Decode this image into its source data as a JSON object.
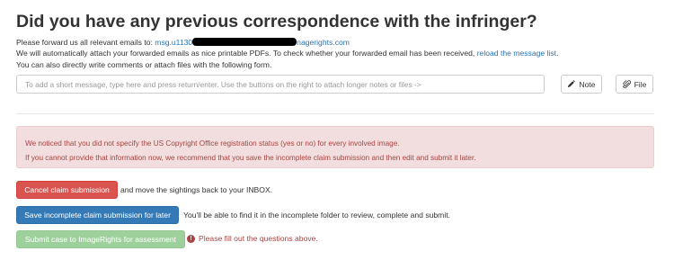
{
  "heading": "Did you have any previous correspondence with the infringer?",
  "instructions": {
    "line1_prefix": "Please forward us all relevant emails to: ",
    "email_start": "msg.u1130",
    "email_end": "nagerights.com",
    "line2_prefix": "We will automatically attach your forwarded emails as nice printable PDFs. To check whether your forwarded email has been received, ",
    "reload_link": "reload the message list",
    "line2_suffix": ".",
    "line3": "You can also directly write comments or attach files with the following form."
  },
  "message_input": {
    "placeholder": "To add a short message, type here and press return/enter. Use the buttons on the right to attach longer notes or files ->",
    "value": ""
  },
  "buttons": {
    "note": "Note",
    "file": "File",
    "cancel": "Cancel claim submission",
    "save": "Save incomplete claim submission for later",
    "submit": "Submit case to ImageRights for assessment"
  },
  "icons": {
    "note": "pencil-icon",
    "file": "paperclip-icon",
    "warning": "exclamation-circle-icon"
  },
  "alert": {
    "line1": "We noticed that you did not specify the US Copyright Office registration status (yes or no) for every involved image.",
    "line2": "If you cannot provide that information now, we recommend that you save the incomplete claim submission and then edit and submit it later."
  },
  "texts": {
    "after_cancel": "and move the sightings back to your INBOX.",
    "after_save": "You'll be able to find it in the incomplete folder to review, complete and submit.",
    "warning": "Please fill out the questions above."
  },
  "colors": {
    "link": "#2a72b5",
    "danger": "#d9534f",
    "primary": "#337ab7",
    "success_disabled": "#9ed09c",
    "alert_bg": "#f2dede",
    "alert_text": "#a94442"
  }
}
